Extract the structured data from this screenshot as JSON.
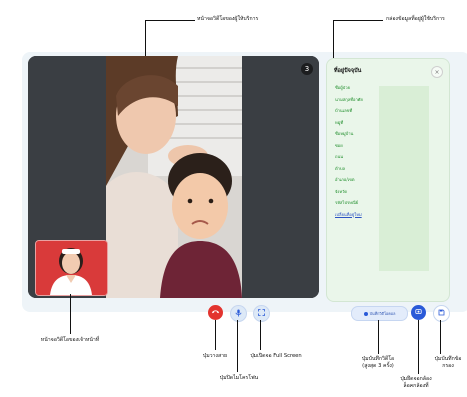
{
  "annotations": {
    "provider_video": "หน้าจอวิดีโอของผู้ให้บริการ",
    "info_box": "กล่องข้อมูลที่อยู่ผู้ใช้บริการ",
    "staff_video": "หน้าจอวิดีโอของเจ้าหน้าที่",
    "hangup": "ปุ่มวางสาย",
    "mic": "ปุ่มปิดไมโครโฟน",
    "fullscreen": "ปุ่มเปิดจอ Full Screen",
    "switch_video": "ปุ่มบันทึกวิดีโอ",
    "switch_video_sub": "(สูงสุด 3 ครั้ง)",
    "switch_camera": "ปุ่มยึดจอกล้อง",
    "switch_camera_sub": "ล็อคกล้องที่",
    "save_info": "ปุ่มบันทึกข้อ",
    "save_info_sub": "กรอง"
  },
  "side_panel": {
    "title": "ที่อยู่ปัจจุบัน",
    "fields": [
      "ชื่อผู้ป่วย",
      "นามสกุลที่อาศัย",
      "บ้านเลขที่",
      "หมู่ที่",
      "ชื่อหมู่บ้าน",
      "ซอย",
      "ถนน",
      "ตำบล",
      "อำเภอ/เขต",
      "จังหวัด",
      "รหัสไปรษณีย์"
    ],
    "link": "เปลี่ยนที่อยู่ใหม่"
  },
  "controls": {
    "record_label": "บันทึกวิดีโอคอล",
    "close_symbol": "×",
    "badge_symbol": "3"
  },
  "colors": {
    "hangup": "#e3342f",
    "control_bg": "#dde9f7",
    "accent_blue": "#2a5ad8"
  },
  "icons": [
    "phone-hangup-icon",
    "mic-icon",
    "fullscreen-icon",
    "record-icon",
    "camera-switch-icon",
    "save-icon"
  ]
}
